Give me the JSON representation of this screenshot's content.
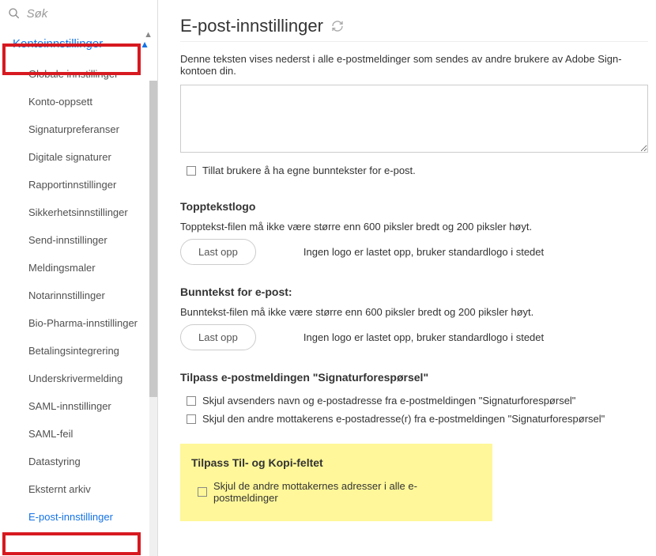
{
  "search": {
    "placeholder": "Søk"
  },
  "sidebar": {
    "header": "Kontoinnstillinger",
    "items": [
      {
        "label": "Globale innstillinger"
      },
      {
        "label": "Konto-oppsett"
      },
      {
        "label": "Signaturpreferanser"
      },
      {
        "label": "Digitale signaturer"
      },
      {
        "label": "Rapportinnstillinger"
      },
      {
        "label": "Sikkerhetsinnstillinger"
      },
      {
        "label": "Send-innstillinger"
      },
      {
        "label": "Meldingsmaler"
      },
      {
        "label": "Notarinnstillinger"
      },
      {
        "label": "Bio-Pharma-innstillinger"
      },
      {
        "label": "Betalingsintegrering"
      },
      {
        "label": "Underskrivermelding"
      },
      {
        "label": "SAML-innstillinger"
      },
      {
        "label": "SAML-feil"
      },
      {
        "label": "Datastyring"
      },
      {
        "label": "Eksternt arkiv"
      },
      {
        "label": "E-post-innstillinger"
      }
    ]
  },
  "main": {
    "title": "E-post-innstillinger",
    "description": "Denne teksten vises nederst i alle e-postmeldinger som sendes av andre brukere av Adobe Sign-kontoen din.",
    "footer_textarea_value": "",
    "checkbox_own_footer": "Tillat brukere å ha egne bunntekster for e-post.",
    "section_header_logo": "Topptekstlogo",
    "header_logo_info": "Topptekst-filen må ikke være større enn 600 piksler bredt og 200 piksler høyt.",
    "upload_button_header": "Last opp",
    "header_logo_status": "Ingen logo er lastet opp, bruker standardlogo i stedet",
    "section_footer_email": "Bunntekst for e-post:",
    "footer_email_info": "Bunntekst-filen må ikke være større enn 600 piksler bredt og 200 piksler høyt.",
    "upload_button_footer": "Last opp",
    "footer_logo_status": "Ingen logo er lastet opp, bruker standardlogo i stedet",
    "section_customize_signreq": "Tilpass e-postmeldingen \"Signaturforespørsel\"",
    "checkbox_hide_sender": "Skjul avsenders navn og e-postadresse fra e-postmeldingen \"Signaturforespørsel\"",
    "checkbox_hide_other_recipient": "Skjul den andre mottakerens e-postadresse(r) fra e-postmeldingen \"Signaturforespørsel\"",
    "section_customize_tocc": "Tilpass Til- og Kopi-feltet",
    "checkbox_hide_all_recipients": "Skjul de andre mottakernes adresser i alle e-postmeldinger"
  }
}
